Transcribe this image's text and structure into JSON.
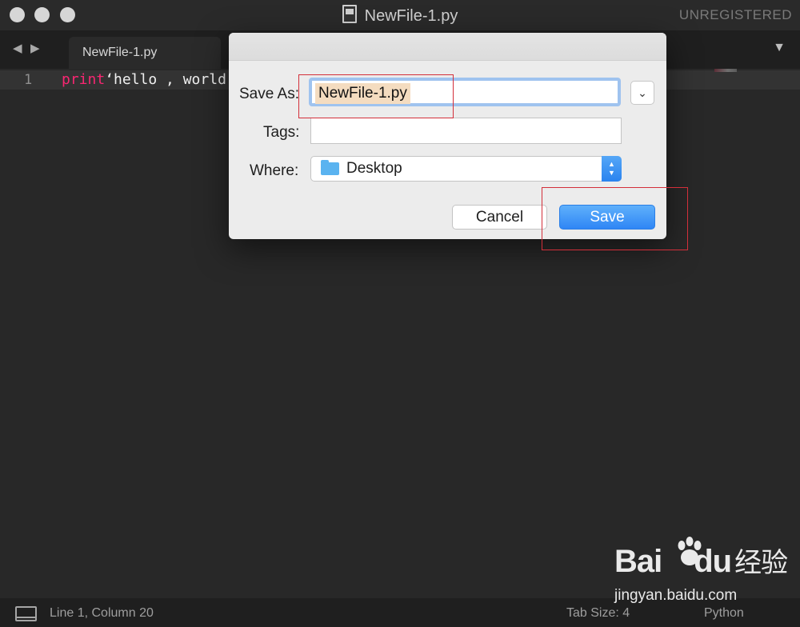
{
  "window": {
    "title": "NewFile-1.py",
    "registration": "UNREGISTERED"
  },
  "tabs": [
    {
      "label": "NewFile-1.py"
    }
  ],
  "editor": {
    "line_number": "1",
    "code_keyword": "print",
    "code_rest": "‘hello , world"
  },
  "dialog": {
    "save_as_label": "Save As:",
    "save_as_value": "NewFile-1.py",
    "tags_label": "Tags:",
    "tags_value": "",
    "where_label": "Where:",
    "where_value": "Desktop",
    "cancel_label": "Cancel",
    "save_label": "Save"
  },
  "statusbar": {
    "position": "Line 1, Column 20",
    "tab_size": "Tab Size: 4",
    "syntax": "Python"
  },
  "watermark": {
    "brand": "Bai",
    "brand_suffix": "du",
    "brand_cn": "经验",
    "site": "jingyan.baidu.com"
  },
  "colors": {
    "accent": "#2f86f5",
    "annotation": "#d32f3a",
    "keyword": "#f92672"
  }
}
